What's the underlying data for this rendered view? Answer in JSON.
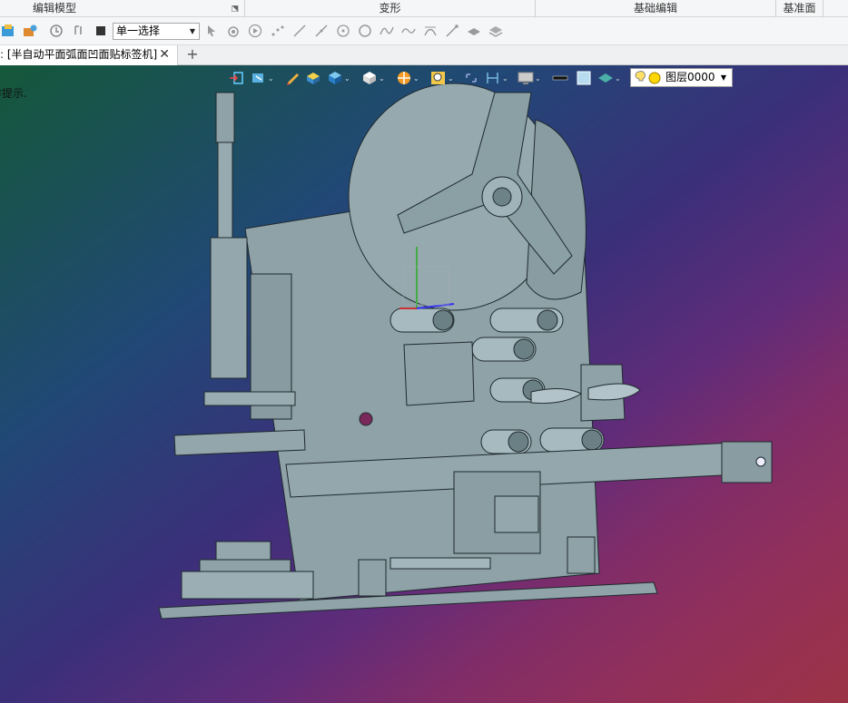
{
  "ribbon": {
    "groups": [
      {
        "label": "编辑模型"
      },
      {
        "label": "变形"
      },
      {
        "label": "基础编辑"
      },
      {
        "label": "基准面"
      }
    ]
  },
  "toolbar": {
    "select_mode": "单一选择",
    "icons": [
      "save-to-library-icon",
      "library-icon",
      "rotate-view-icon",
      "undo-history-icon",
      "box-select-icon",
      "pointer-select-icon",
      "component-select-icon",
      "play-icon",
      "points-icon",
      "line-icon",
      "line-tool-icon",
      "circle-point-icon",
      "circle-icon",
      "spline-icon",
      "curve-icon",
      "arc-icon",
      "segment-icon",
      "face-tool-icon",
      "solid-tool-icon"
    ]
  },
  "tabs": {
    "document_title": "[半自动平面弧面凹面贴标签机]",
    "close_glyph": "✕",
    "add_glyph": "+"
  },
  "viewport": {
    "prompt": "操作提示.",
    "layer": "图层0000",
    "background_colors": [
      "#15583a",
      "#214876",
      "#3b2f7a",
      "#a52a87",
      "#963728"
    ],
    "model_color": "#8fa3a8"
  }
}
